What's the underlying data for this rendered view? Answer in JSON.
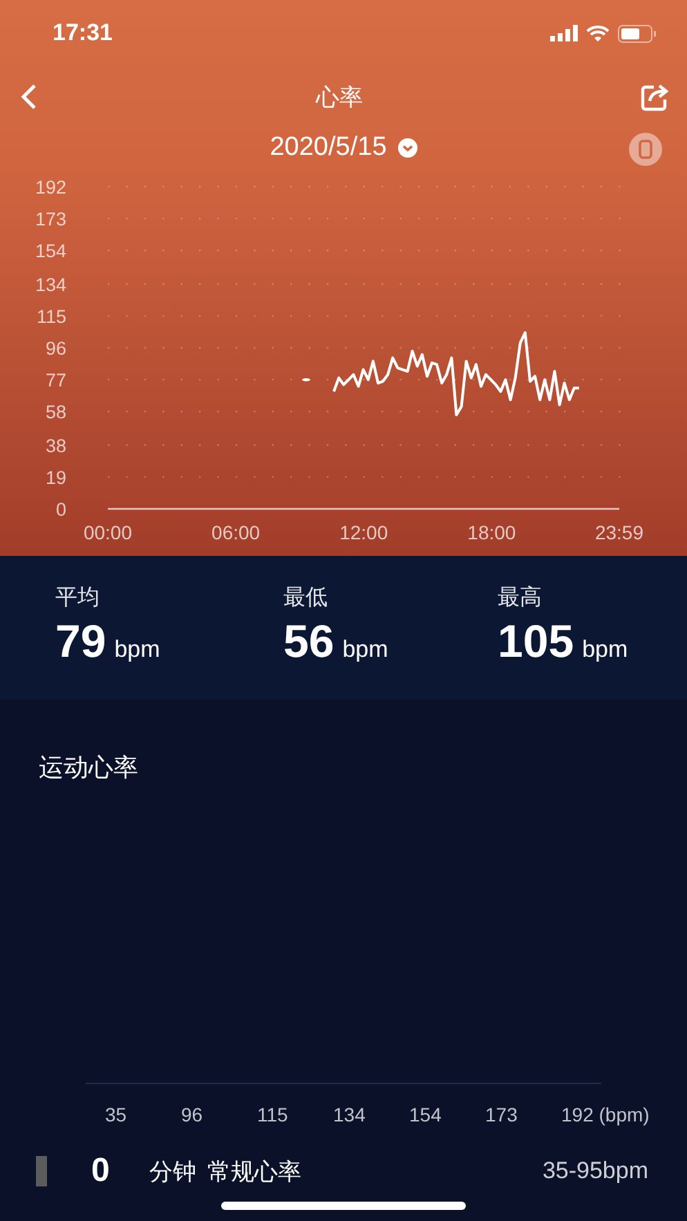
{
  "status_bar": {
    "time": "17:31"
  },
  "nav": {
    "title": "心率"
  },
  "date": {
    "label": "2020/5/15"
  },
  "chart": {
    "chart_data": {
      "type": "line",
      "ylim": [
        0,
        192
      ],
      "yticks": [
        0,
        19,
        38,
        58,
        77,
        96,
        115,
        134,
        154,
        173,
        192
      ],
      "xlim": [
        0,
        23.983
      ],
      "xticks": [
        {
          "value": 0,
          "label": "00:00"
        },
        {
          "value": 6,
          "label": "06:00"
        },
        {
          "value": 12,
          "label": "12:00"
        },
        {
          "value": 18,
          "label": "18:00"
        },
        {
          "value": 23.983,
          "label": "23:59"
        }
      ],
      "grid": true,
      "x": [
        9.3,
        10.6,
        10.83,
        11.06,
        11.29,
        11.52,
        11.75,
        11.98,
        12.21,
        12.44,
        12.67,
        12.9,
        13.13,
        13.36,
        13.59,
        13.82,
        14.05,
        14.28,
        14.51,
        14.74,
        14.97,
        15.2,
        15.43,
        15.66,
        15.89,
        16.12,
        16.35,
        16.58,
        16.81,
        17.04,
        17.27,
        17.5,
        17.73,
        17.96,
        18.19,
        18.42,
        18.65,
        18.88,
        19.11,
        19.34,
        19.57,
        19.8,
        20.03,
        20.26,
        20.49,
        20.72,
        20.95,
        21.18,
        21.41,
        21.64,
        21.87,
        22.1
      ],
      "series": [
        {
          "color": "#ffffff",
          "marker": "circle",
          "values": [
            77,
            null,
            null,
            null,
            null,
            null,
            null,
            null,
            null,
            null,
            null,
            null,
            null,
            null,
            null,
            null,
            null,
            null,
            null,
            null,
            null,
            null,
            null,
            null,
            null,
            null,
            null,
            null,
            null,
            null,
            null,
            null,
            null,
            null,
            null,
            null,
            null,
            null,
            null,
            null,
            null,
            null,
            null,
            null,
            null,
            null,
            null,
            null,
            null,
            null,
            null,
            null
          ]
        },
        {
          "color": "#ffffff",
          "values": [
            null,
            70,
            78,
            74,
            77,
            80,
            73,
            83,
            77,
            88,
            75,
            76,
            80,
            90,
            84,
            83,
            82,
            94,
            85,
            92,
            79,
            87,
            86,
            75,
            80,
            90,
            56,
            61,
            88,
            78,
            86,
            73,
            80,
            77,
            74,
            70,
            77,
            65,
            78,
            99,
            105,
            76,
            79,
            65,
            77,
            65,
            82,
            62,
            75,
            65,
            72,
            72
          ]
        }
      ]
    }
  },
  "stats": [
    {
      "label": "平均",
      "value": "79",
      "unit": "bpm"
    },
    {
      "label": "最低",
      "value": "56",
      "unit": "bpm"
    },
    {
      "label": "最高",
      "value": "105",
      "unit": "bpm"
    }
  ],
  "zones": {
    "title": "运动心率",
    "axis_labels": [
      "35",
      "96",
      "115",
      "134",
      "154",
      "173",
      "192 (bpm)"
    ],
    "rows": [
      {
        "minutes": "0",
        "unit": "分钟",
        "name": "常规心率",
        "range": "35-95bpm",
        "color": "#5c5c5c"
      }
    ]
  }
}
